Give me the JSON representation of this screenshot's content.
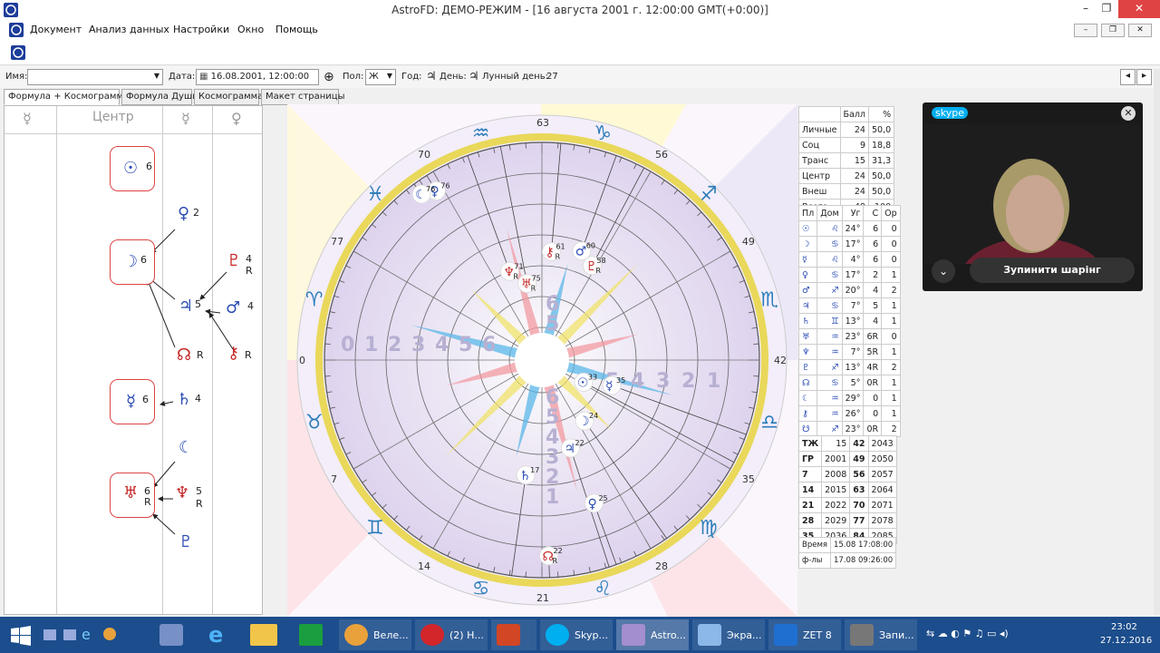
{
  "window": {
    "title": "AstroFD: ДЕМО-РЕЖИМ - [16 августа 2001 г. 12:00:00 GMT(+0:00)]",
    "min": "–",
    "max": "❐",
    "close": "✕"
  },
  "menu": [
    "Документ",
    "Анализ данных",
    "Настройки",
    "Окно",
    "Помощь"
  ],
  "toolbar": {
    "name_label": "Имя:",
    "name_value": "",
    "date_label": "Дата:",
    "date_value": "16.08.2001, 12:00:00",
    "sex_label": "Пол:",
    "sex_value": "Ж",
    "year_label": "Год:",
    "year_glyph": "♃",
    "day_label": "День:",
    "day_glyph": "♃",
    "moon_day_label": "Лунный день:",
    "moon_day_value": "27"
  },
  "tabs": [
    "Формула + Космограмма",
    "Формула Души",
    "Космограмма",
    "Макет страницы"
  ],
  "left_panel": {
    "headers": [
      "☿",
      "Центр",
      "☿",
      "♀"
    ],
    "boxes": [
      {
        "glyph": "☉",
        "n": "6"
      },
      {
        "glyph": "☽",
        "n": "6"
      },
      {
        "glyph": "☿",
        "n": "6"
      },
      {
        "glyph": "♅",
        "n": "6",
        "r": "R"
      }
    ],
    "nodes": [
      {
        "glyph": "♀",
        "n": "2"
      },
      {
        "glyph": "♇",
        "n": "4",
        "r": "R"
      },
      {
        "glyph": "♃",
        "n": "5"
      },
      {
        "glyph": "♂",
        "n": "4"
      },
      {
        "glyph": "☊",
        "n": "",
        "r": "R"
      },
      {
        "glyph": "⚷",
        "n": "",
        "r": "R"
      },
      {
        "glyph": "♄",
        "n": "4"
      },
      {
        "glyph": "☾",
        "n": ""
      },
      {
        "glyph": "♆",
        "n": "5",
        "r": "R"
      },
      {
        "glyph": "♇",
        "n": ""
      }
    ]
  },
  "chart": {
    "degree_labels": [
      "63",
      "56",
      "49",
      "42",
      "35",
      "28",
      "21",
      "14",
      "7",
      "0",
      "77",
      "70"
    ],
    "signs": [
      "♑",
      "♐",
      "♏",
      "♎",
      "♍",
      "♌",
      "♋",
      "♊",
      "♉",
      "♈",
      "♓",
      "♒"
    ],
    "planets": [
      {
        "glyph": "⚷",
        "n": "61",
        "r": "R"
      },
      {
        "glyph": "♂",
        "n": "60"
      },
      {
        "glyph": "♇",
        "n": "58",
        "r": "R"
      },
      {
        "glyph": "♀",
        "n": "76"
      },
      {
        "glyph": "☾",
        "n": "76"
      },
      {
        "glyph": "♆",
        "n": "71",
        "r": "R"
      },
      {
        "glyph": "♅",
        "n": "75",
        "r": "R"
      },
      {
        "glyph": "☿",
        "n": "35"
      },
      {
        "glyph": "☉",
        "n": "33"
      },
      {
        "glyph": "☽",
        "n": "24"
      },
      {
        "glyph": "♃",
        "n": "22"
      },
      {
        "glyph": "♄",
        "n": "17"
      },
      {
        "glyph": "♀",
        "n": "25"
      },
      {
        "glyph": "☊",
        "n": "22",
        "r": "R"
      }
    ],
    "ring_left": [
      "0",
      "1",
      "2",
      "3",
      "4",
      "5",
      "6"
    ],
    "ring_bottom": [
      "6",
      "5",
      "4",
      "3",
      "2",
      "1"
    ],
    "ring_top": [
      "6",
      "5"
    ],
    "ring_right": [
      "5",
      "4",
      "3",
      "2",
      "1"
    ]
  },
  "score_table": {
    "head": [
      "",
      "Балл",
      "%"
    ],
    "rows": [
      [
        "Личные",
        "24",
        "50,0"
      ],
      [
        "Соц",
        "9",
        "18,8"
      ],
      [
        "Транс",
        "15",
        "31,3"
      ],
      [
        "Центр",
        "24",
        "50,0"
      ],
      [
        "Внеш",
        "24",
        "50,0"
      ],
      [
        "Всего",
        "48",
        "100"
      ]
    ]
  },
  "planet_table": {
    "head": [
      "Пл",
      "Дом",
      "Уг",
      "С",
      "Ор"
    ],
    "rows": [
      [
        "☉",
        "♌",
        "24°",
        "6",
        "0"
      ],
      [
        "☽",
        "♋",
        "17°",
        "6",
        "0"
      ],
      [
        "☿",
        "♌",
        "4°",
        "6",
        "0"
      ],
      [
        "♀",
        "♋",
        "17°",
        "2",
        "1"
      ],
      [
        "♂",
        "♐",
        "20°",
        "4",
        "2"
      ],
      [
        "♃",
        "♋",
        "7°",
        "5",
        "1"
      ],
      [
        "♄",
        "♊",
        "13°",
        "4",
        "1"
      ],
      [
        "♅",
        "♒",
        "23°",
        "6R",
        "0"
      ],
      [
        "♆",
        "♒",
        "7°",
        "5R",
        "1"
      ],
      [
        "♇",
        "♐",
        "13°",
        "4R",
        "2"
      ],
      [
        "☊",
        "♋",
        "5°",
        "0R",
        "1"
      ],
      [
        "☾",
        "♒",
        "29°",
        "0",
        "1"
      ],
      [
        "⚷",
        "♒",
        "26°",
        "0",
        "1"
      ],
      [
        "☋",
        "♐",
        "23°",
        "0R",
        "2"
      ]
    ]
  },
  "year_table": [
    [
      "ТЖ",
      "15",
      "42",
      "2043"
    ],
    [
      "ГР",
      "2001",
      "49",
      "2050"
    ],
    [
      "7",
      "2008",
      "56",
      "2057"
    ],
    [
      "14",
      "2015",
      "63",
      "2064"
    ],
    [
      "21",
      "2022",
      "70",
      "2071"
    ],
    [
      "28",
      "2029",
      "77",
      "2078"
    ],
    [
      "35",
      "2036",
      "84",
      "2085"
    ]
  ],
  "time_table": [
    [
      "Время",
      "15.08 17:08:00"
    ],
    [
      "ф-лы",
      "17.08 09:26:00"
    ]
  ],
  "skype": {
    "logo": "skype",
    "stop_label": "Зупинити шарінг"
  },
  "taskbar": {
    "items": [
      {
        "label": "Веле..."
      },
      {
        "label": "(2) Н..."
      },
      {
        "label": ""
      },
      {
        "label": "Skyp..."
      },
      {
        "label": "Astro..."
      },
      {
        "label": "Экра..."
      },
      {
        "label": "ZET 8"
      },
      {
        "label": "Запи..."
      }
    ],
    "time": "23:02",
    "date": "27.12.2016"
  },
  "colors": {
    "accent": "#2d4db5",
    "red": "#c62828",
    "taskbar": "#1c4d8c"
  }
}
